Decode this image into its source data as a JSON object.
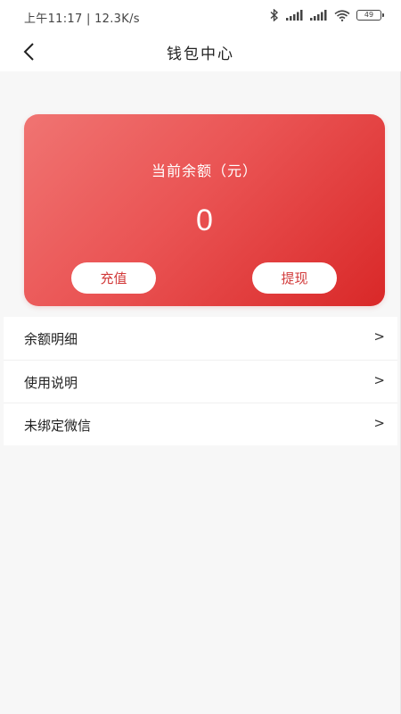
{
  "status_bar": {
    "time_speed": "上午11:17 | 12.3K/s",
    "battery": "49"
  },
  "header": {
    "title": "钱包中心"
  },
  "wallet": {
    "balance_label": "当前余额（元）",
    "balance_value": "0",
    "recharge_label": "充值",
    "withdraw_label": "提现",
    "card_gradient": [
      "#f07472",
      "#ea5454",
      "#d92828"
    ],
    "button_text_color": "#d23b3b"
  },
  "menu": {
    "items": [
      {
        "label": "余额明细",
        "arrow": ">"
      },
      {
        "label": "使用说明",
        "arrow": ">"
      },
      {
        "label": "未绑定微信",
        "arrow": ">"
      }
    ]
  }
}
